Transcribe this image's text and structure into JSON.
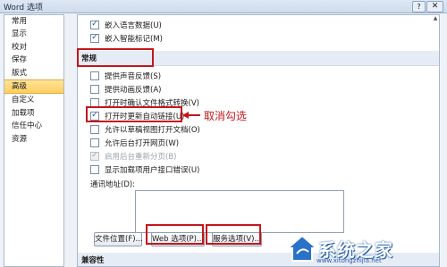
{
  "window": {
    "title": "Word 选项",
    "help_label": "?",
    "close_label": "✕"
  },
  "sidebar": {
    "items": [
      {
        "label": "常用",
        "selected": false
      },
      {
        "label": "显示",
        "selected": false
      },
      {
        "label": "校对",
        "selected": false
      },
      {
        "label": "保存",
        "selected": false
      },
      {
        "label": "版式",
        "selected": false
      },
      {
        "label": "高级",
        "selected": true
      },
      {
        "label": "自定义",
        "selected": false
      },
      {
        "label": "加载项",
        "selected": false
      },
      {
        "label": "信任中心",
        "selected": false
      },
      {
        "label": "资源",
        "selected": false
      }
    ]
  },
  "options_top": [
    {
      "label": "嵌入语言数据(U)",
      "checked": true
    },
    {
      "label": "嵌入智能标记(M)",
      "checked": true
    }
  ],
  "sections": {
    "general": "常规",
    "compat": "兼容性"
  },
  "general_options": [
    {
      "label": "提供声音反馈(S)",
      "checked": false,
      "disabled": false
    },
    {
      "label": "提供动画反馈(A)",
      "checked": false,
      "disabled": false
    },
    {
      "label": "打开时确认文件格式转换(V)",
      "checked": false,
      "disabled": false
    },
    {
      "label": "打开时更新自动链接(U)",
      "checked": true,
      "disabled": false
    },
    {
      "label": "允许以草稿视图打开文档(O)",
      "checked": false,
      "disabled": false
    },
    {
      "label": "允许后台打开网页(W)",
      "checked": false,
      "disabled": false
    },
    {
      "label": "启用后台重新分页(B)",
      "checked": true,
      "disabled": true
    },
    {
      "label": "显示加载项用户接口错误(U)",
      "checked": false,
      "disabled": false
    }
  ],
  "mailing_address_label": "通讯地址(D):",
  "buttons": {
    "file_locations": "文件位置(F)...",
    "web_options": "Web 选项(P)...",
    "service_options": "服务选项(V)..."
  },
  "annotation": {
    "text": "取消勾选"
  },
  "watermark": {
    "text": "系统之家",
    "url": "www.xitongzhijia.net"
  },
  "colors": {
    "annotation_red": "#c4161c",
    "selected_nav": "#ffcf5e"
  }
}
